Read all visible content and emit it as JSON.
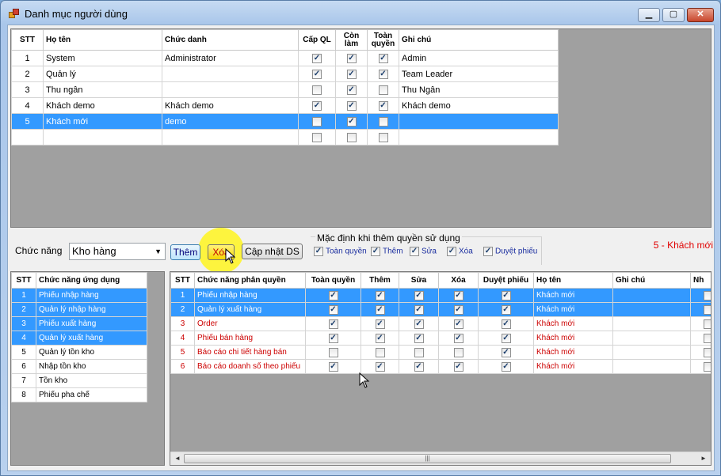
{
  "window": {
    "title": "Danh mục người dùng",
    "minimize": "▁",
    "maximize": "▢",
    "close": "✕"
  },
  "user_grid": {
    "columns": [
      "STT",
      "Họ tên",
      "Chức danh",
      "Cấp QL",
      "Còn làm",
      "Toàn quyền",
      "Ghi chú"
    ],
    "rows": [
      {
        "stt": "1",
        "name": "System",
        "title": "Administrator",
        "cap_ql": true,
        "con_lam": true,
        "toan_quyen": true,
        "note": "Admin",
        "selected": false
      },
      {
        "stt": "2",
        "name": "Quản lý",
        "title": "",
        "cap_ql": true,
        "con_lam": true,
        "toan_quyen": true,
        "note": "Team Leader",
        "selected": false
      },
      {
        "stt": "3",
        "name": "Thu ngân",
        "title": "",
        "cap_ql": false,
        "con_lam": true,
        "toan_quyen": false,
        "note": "Thu Ngân",
        "selected": false
      },
      {
        "stt": "4",
        "name": "Khách demo",
        "title": "Khách demo",
        "cap_ql": true,
        "con_lam": true,
        "toan_quyen": true,
        "note": "Khách demo",
        "selected": false
      },
      {
        "stt": "5",
        "name": "Khách mới",
        "title": "demo",
        "cap_ql": false,
        "con_lam": true,
        "toan_quyen": false,
        "note": "",
        "selected": true
      },
      {
        "stt": "",
        "name": "",
        "title": "",
        "cap_ql": false,
        "con_lam": false,
        "toan_quyen": false,
        "note": "",
        "selected": false
      }
    ]
  },
  "toolbar": {
    "function_label": "Chức năng",
    "function_value": "Kho hàng",
    "add_label": "Thêm",
    "delete_label": "Xóa",
    "update_label": "Cập nhật DS",
    "defaults_title": "Mặc định khi thêm quyền sử dụng",
    "defaults": [
      {
        "label": "Toàn quyền",
        "checked": true
      },
      {
        "label": "Thêm",
        "checked": true
      },
      {
        "label": "Sửa",
        "checked": true
      },
      {
        "label": "Xóa",
        "checked": true
      },
      {
        "label": "Duyệt phiếu",
        "checked": true
      }
    ],
    "selected_user_text": "5 - Khách mới"
  },
  "function_grid": {
    "columns": [
      "STT",
      "Chức năng ứng dụng"
    ],
    "rows": [
      {
        "stt": "1",
        "name": "Phiếu nhập hàng",
        "selected": true
      },
      {
        "stt": "2",
        "name": "Quản lý nhập hàng",
        "selected": true
      },
      {
        "stt": "3",
        "name": "Phiếu xuất hàng",
        "selected": true
      },
      {
        "stt": "4",
        "name": "Quản lý xuất hàng",
        "selected": true
      },
      {
        "stt": "5",
        "name": "Quản lý tồn kho",
        "selected": false
      },
      {
        "stt": "6",
        "name": "Nhập tồn kho",
        "selected": false
      },
      {
        "stt": "7",
        "name": "Tồn kho",
        "selected": false
      },
      {
        "stt": "8",
        "name": "Phiếu pha chế",
        "selected": false
      }
    ]
  },
  "permission_grid": {
    "columns": [
      "STT",
      "Chức năng phân quyền",
      "Toàn quyền",
      "Thêm",
      "Sửa",
      "Xóa",
      "Duyệt phiếu",
      "Họ tên",
      "Ghi chú",
      "Nh"
    ],
    "rows": [
      {
        "stt": "1",
        "name": "Phiếu nhập hàng",
        "toan_quyen": true,
        "them": true,
        "sua": true,
        "xoa": true,
        "duyet": true,
        "user": "Khách mới",
        "note": "",
        "selected": true
      },
      {
        "stt": "2",
        "name": "Quản lý xuất hàng",
        "toan_quyen": true,
        "them": true,
        "sua": true,
        "xoa": true,
        "duyet": true,
        "user": "Khách mới",
        "note": "",
        "selected": true
      },
      {
        "stt": "3",
        "name": "Order",
        "toan_quyen": true,
        "them": true,
        "sua": true,
        "xoa": true,
        "duyet": true,
        "user": "Khách mới",
        "note": "",
        "selected": false
      },
      {
        "stt": "4",
        "name": "Phiếu bán hàng",
        "toan_quyen": true,
        "them": true,
        "sua": true,
        "xoa": true,
        "duyet": true,
        "user": "Khách mới",
        "note": "",
        "selected": false
      },
      {
        "stt": "5",
        "name": "Báo cáo chi tiết hàng bán",
        "toan_quyen": false,
        "them": false,
        "sua": false,
        "xoa": false,
        "duyet": true,
        "user": "Khách mới",
        "note": "",
        "selected": false
      },
      {
        "stt": "6",
        "name": "Báo cáo doanh số theo phiếu",
        "toan_quyen": true,
        "them": true,
        "sua": true,
        "xoa": true,
        "duyet": true,
        "user": "Khách mới",
        "note": "",
        "selected": false
      }
    ],
    "scroll_left": "◄",
    "scroll_right": "►",
    "scroll_grip": "|||"
  }
}
